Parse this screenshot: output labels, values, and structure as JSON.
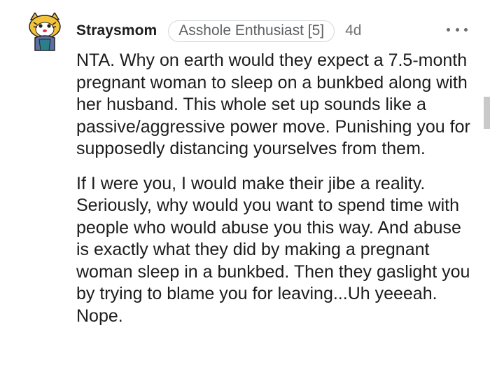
{
  "comment": {
    "author": "Straysmom",
    "flair": "Asshole Enthusiast [5]",
    "age": "4d",
    "paragraphs": [
      "NTA. Why on earth would they expect a 7.5-month pregnant woman to sleep on a bunkbed along with her husband. This whole set up sounds like a passive/aggressive power move. Punishing you for supposedly distancing yourselves from them.",
      "If I were you, I would make their jibe a reality. Seriously, why would you want to spend time with people who would abuse you this way. And abuse is exactly what they did by making a pregnant woman sleep in a bunkbed. Then they gaslight you by trying to blame you for leaving...Uh yeeeah. Nope."
    ]
  },
  "icons": {
    "avatar": "snoo-avatar-icon",
    "more": "more-options-icon"
  },
  "colors": {
    "text": "#1c1c1c",
    "meta": "#6d7174",
    "flair_border": "#d4d7da",
    "avatar_fur": "#f3c33c"
  }
}
